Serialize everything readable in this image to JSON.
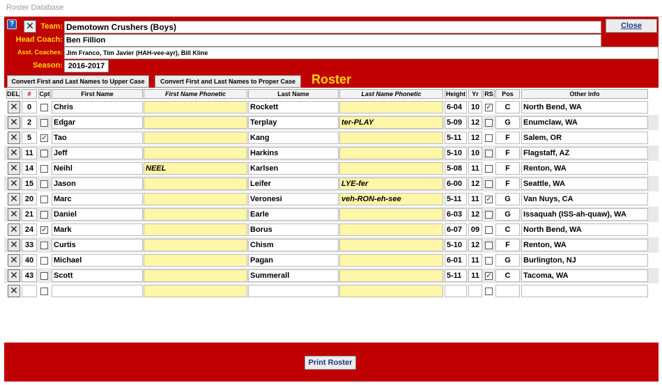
{
  "window": {
    "title": "Roster Database"
  },
  "header": {
    "team_label": "Team:",
    "team_value": "Demotown Crushers (Boys)",
    "head_coach_label": "Head Coach:",
    "head_coach_value": "Ben Fillion",
    "asst_label": "Asst. Coaches:",
    "asst_value": "Jim Franco, Tim Javier (HAH-vee-ayr), Bill Kline",
    "season_label": "Season:",
    "season_value": "2016-2017",
    "close_label": "Close"
  },
  "toolbar": {
    "upper_label": "Convert First and Last Names to Upper Case",
    "proper_label": "Convert First and Last Names to Proper Case"
  },
  "roster_title": "Roster",
  "columns": {
    "del": "DEL",
    "num": "#",
    "cpt": "Cpt",
    "first": "First Name",
    "first_ph": "First Name Phonetic",
    "last": "Last Name",
    "last_ph": "Last Name Phonetic",
    "height": "Height",
    "yr": "Yr",
    "rs": "RS",
    "pos": "Pos",
    "other": "Other Info"
  },
  "rows": [
    {
      "num": "0",
      "cpt": false,
      "first": "Chris",
      "first_ph": "",
      "last": "Rockett",
      "last_ph": "",
      "height": "6-04",
      "yr": "10",
      "rs": true,
      "pos": "C",
      "other": "North Bend, WA"
    },
    {
      "num": "2",
      "cpt": false,
      "first": "Edgar",
      "first_ph": "",
      "last": "Terplay",
      "last_ph": "ter-PLAY",
      "height": "5-09",
      "yr": "12",
      "rs": false,
      "pos": "G",
      "other": "Enumclaw, WA"
    },
    {
      "num": "5",
      "cpt": true,
      "first": "Tao",
      "first_ph": "",
      "last": "Kang",
      "last_ph": "",
      "height": "5-11",
      "yr": "12",
      "rs": false,
      "pos": "F",
      "other": "Salem, OR"
    },
    {
      "num": "11",
      "cpt": false,
      "first": "Jeff",
      "first_ph": "",
      "last": "Harkins",
      "last_ph": "",
      "height": "5-10",
      "yr": "10",
      "rs": false,
      "pos": "F",
      "other": "Flagstaff, AZ"
    },
    {
      "num": "14",
      "cpt": false,
      "first": "Neihl",
      "first_ph": "NEEL",
      "last": "Karlsen",
      "last_ph": "",
      "height": "5-08",
      "yr": "11",
      "rs": false,
      "pos": "F",
      "other": "Renton, WA"
    },
    {
      "num": "15",
      "cpt": false,
      "first": "Jason",
      "first_ph": "",
      "last": "Leifer",
      "last_ph": "LYE-fer",
      "height": "6-00",
      "yr": "12",
      "rs": false,
      "pos": "F",
      "other": "Seattle, WA"
    },
    {
      "num": "20",
      "cpt": false,
      "first": "Marc",
      "first_ph": "",
      "last": "Veronesi",
      "last_ph": "veh-RON-eh-see",
      "height": "5-11",
      "yr": "11",
      "rs": true,
      "pos": "G",
      "other": "Van Nuys, CA"
    },
    {
      "num": "21",
      "cpt": false,
      "first": "Daniel",
      "first_ph": "",
      "last": "Earle",
      "last_ph": "",
      "height": "6-03",
      "yr": "12",
      "rs": false,
      "pos": "G",
      "other": "Issaquah (ISS-ah-quaw), WA"
    },
    {
      "num": "24",
      "cpt": true,
      "first": "Mark",
      "first_ph": "",
      "last": "Borus",
      "last_ph": "",
      "height": "6-07",
      "yr": "09",
      "rs": false,
      "pos": "C",
      "other": "North Bend, WA"
    },
    {
      "num": "33",
      "cpt": false,
      "first": "Curtis",
      "first_ph": "",
      "last": "Chism",
      "last_ph": "",
      "height": "5-10",
      "yr": "12",
      "rs": false,
      "pos": "F",
      "other": "Renton, WA"
    },
    {
      "num": "40",
      "cpt": false,
      "first": "Michael",
      "first_ph": "",
      "last": "Pagan",
      "last_ph": "",
      "height": "6-01",
      "yr": "11",
      "rs": false,
      "pos": "G",
      "other": "Burlington, NJ"
    },
    {
      "num": "43",
      "cpt": false,
      "first": "Scott",
      "first_ph": "",
      "last": "Summerall",
      "last_ph": "",
      "height": "5-11",
      "yr": "11",
      "rs": true,
      "pos": "C",
      "other": "Tacoma, WA"
    },
    {
      "num": "",
      "cpt": false,
      "first": "",
      "first_ph": "",
      "last": "",
      "last_ph": "",
      "height": "",
      "yr": "",
      "rs": false,
      "pos": "",
      "other": ""
    }
  ],
  "footer": {
    "print_label": "Print Roster"
  },
  "colors": {
    "form_red": "#c00000",
    "label_yellow": "#ffd700",
    "phonetic_fill": "#fff7a8",
    "button_text": "#1c3a8c"
  },
  "icons": {
    "help": "help-icon",
    "delete": "delete-x-icon",
    "checkbox": "check-icon"
  }
}
